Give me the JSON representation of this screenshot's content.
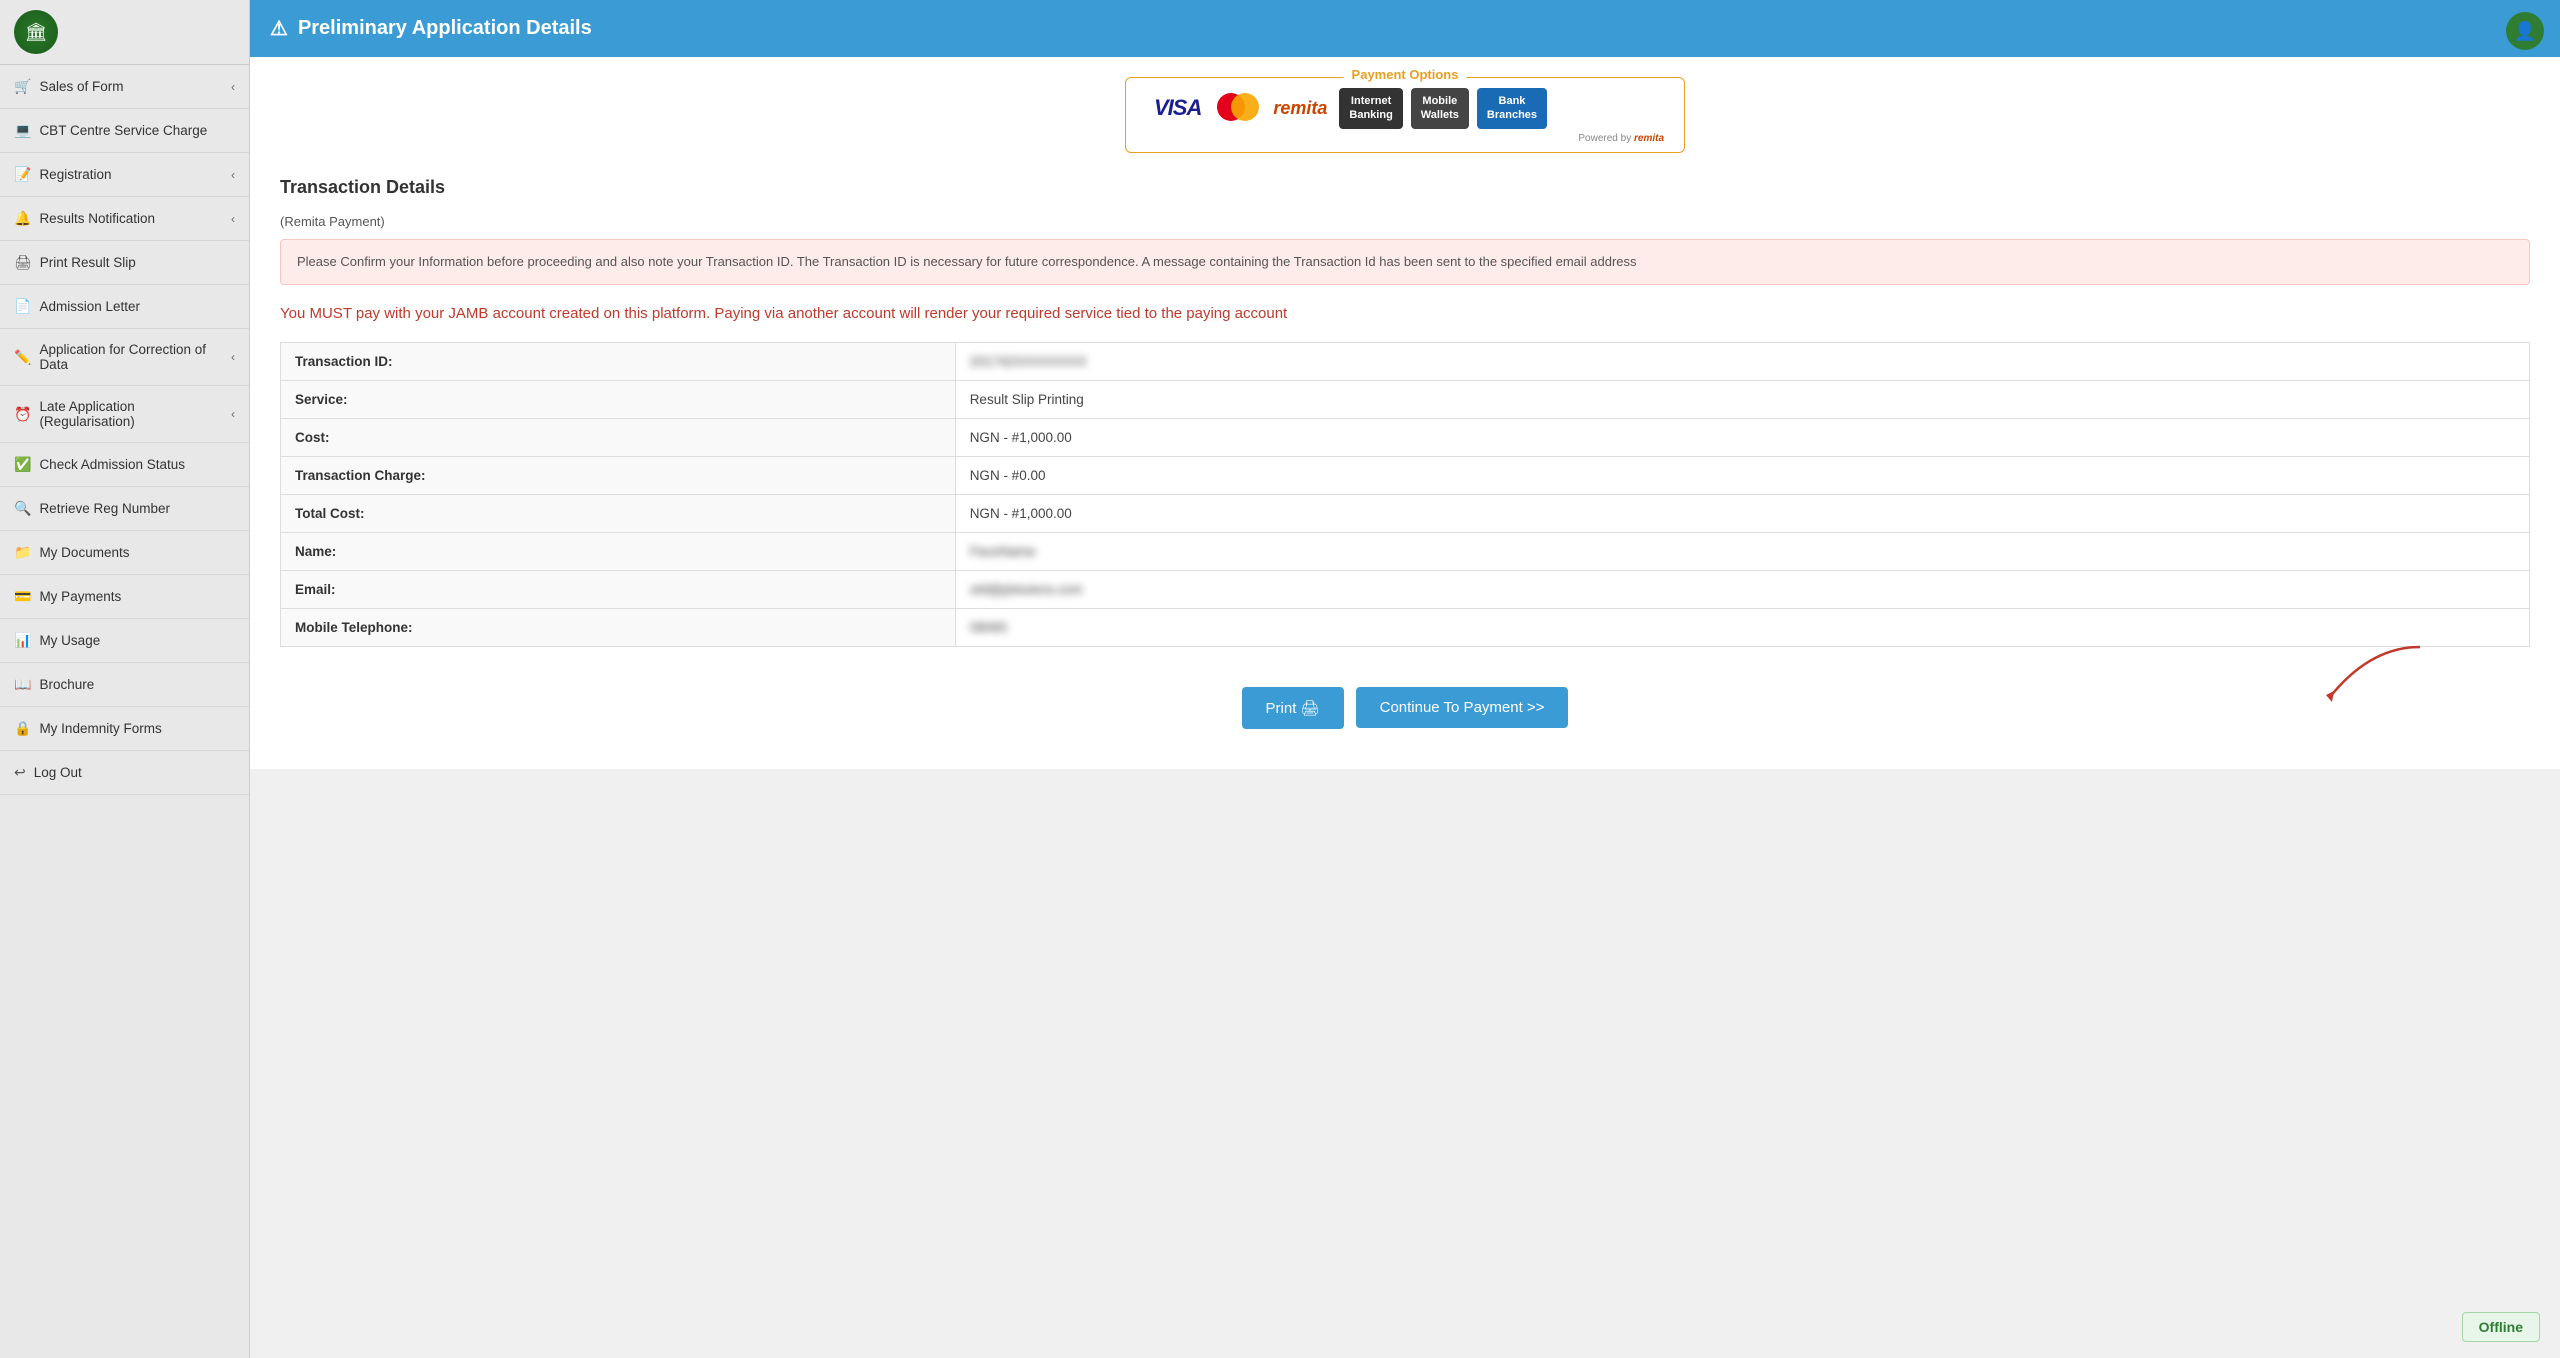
{
  "sidebar": {
    "items": [
      {
        "id": "sales-of-form",
        "label": "Sales of Form",
        "icon": "🛒",
        "hasChevron": true
      },
      {
        "id": "cbt-centre",
        "label": "CBT Centre Service Charge",
        "icon": "💻",
        "hasChevron": false
      },
      {
        "id": "registration",
        "label": "Registration",
        "icon": "📝",
        "hasChevron": true
      },
      {
        "id": "results-notification",
        "label": "Results Notification",
        "icon": "🔔",
        "hasChevron": true
      },
      {
        "id": "print-result-slip",
        "label": "Print Result Slip",
        "icon": "🖨",
        "hasChevron": false
      },
      {
        "id": "admission-letter",
        "label": "Admission Letter",
        "icon": "📄",
        "hasChevron": false
      },
      {
        "id": "application-correction",
        "label": "Application for Correction of Data",
        "icon": "✏️",
        "hasChevron": true
      },
      {
        "id": "late-application",
        "label": "Late Application (Regularisation)",
        "icon": "⏰",
        "hasChevron": true
      },
      {
        "id": "check-admission-status",
        "label": "Check Admission Status",
        "icon": "✅",
        "hasChevron": false
      },
      {
        "id": "retrieve-reg-number",
        "label": "Retrieve Reg Number",
        "icon": "🔍",
        "hasChevron": false
      },
      {
        "id": "my-documents",
        "label": "My Documents",
        "icon": "📁",
        "hasChevron": false
      },
      {
        "id": "my-payments",
        "label": "My Payments",
        "icon": "💳",
        "hasChevron": false
      },
      {
        "id": "my-usage",
        "label": "My Usage",
        "icon": "📊",
        "hasChevron": false
      },
      {
        "id": "brochure",
        "label": "Brochure",
        "icon": "📖",
        "hasChevron": false
      },
      {
        "id": "my-indemnity-forms",
        "label": "My Indemnity Forms",
        "icon": "🔒",
        "hasChevron": false
      },
      {
        "id": "log-out",
        "label": "Log Out",
        "icon": "↩",
        "hasChevron": false
      }
    ]
  },
  "header": {
    "title": "Preliminary Application Details",
    "warning_icon": "⚠"
  },
  "payment_options": {
    "label": "Payment Options",
    "powered_by": "Powered by",
    "buttons": [
      {
        "id": "internet-banking",
        "line1": "Internet",
        "line2": "Banking"
      },
      {
        "id": "mobile-wallets",
        "line1": "Mobile",
        "line2": "Wallets"
      },
      {
        "id": "bank-branches",
        "line1": "Bank",
        "line2": "Branches"
      }
    ]
  },
  "transaction": {
    "title": "Transaction Details",
    "remita_label": "(Remita Payment)",
    "warning_text": "Please Confirm your Information before proceeding and also note your Transaction ID. The Transaction ID is necessary for future correspondence. A message containing the Transaction Id has been sent to the specified email address",
    "jamb_warning": "You MUST pay with your JAMB account created on this platform. Paying via another account will render your required service tied to the paying account",
    "fields": [
      {
        "label": "Transaction ID:",
        "value": "201742",
        "blurred": "XXXXXXXX",
        "is_blurred": true
      },
      {
        "label": "Service:",
        "value": "Result Slip Printing",
        "is_blurred": false
      },
      {
        "label": "Cost:",
        "value": "NGN - #1,000.00",
        "is_blurred": false
      },
      {
        "label": "Transaction Charge:",
        "value": "NGN - #0.00",
        "is_blurred": false
      },
      {
        "label": "Total Cost:",
        "value": "NGN - #1,000.00",
        "is_blurred": false
      },
      {
        "label": "Name:",
        "value": "FaceName",
        "is_blurred": true
      },
      {
        "label": "Email:",
        "value": "old@jdstutera.com",
        "is_blurred": true
      },
      {
        "label": "Mobile Telephone:",
        "value": "08065",
        "is_blurred": true
      }
    ]
  },
  "buttons": {
    "print": "Print 🖨",
    "continue": "Continue To Payment >>"
  },
  "offline_badge": "Offline"
}
